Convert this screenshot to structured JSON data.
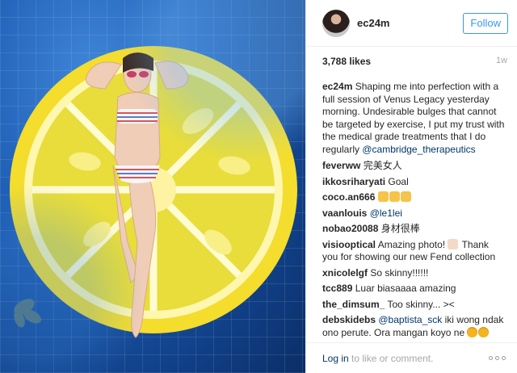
{
  "post": {
    "username": "ec24m",
    "follow_label": "Follow",
    "likes": "3,788 likes",
    "time_ago": "1w"
  },
  "caption": {
    "user": "ec24m",
    "text": "Shaping me into perfection with a full session of Venus Legacy yesterday morning. Undesirable bulges that cannot be targeted by exercise, I put my trust with the medical grade treatments that I do regularly",
    "mention": "@cambridge_therapeutics"
  },
  "comments": [
    {
      "user": "feverww",
      "text": "完美女人"
    },
    {
      "user": "ikkosriharyati",
      "text": "Goal"
    },
    {
      "user": "coco.an666",
      "text": ""
    },
    {
      "user": "vaanlouis",
      "mention": "@le1lei"
    },
    {
      "user": "nobao20088",
      "text": "身材很棒"
    },
    {
      "user": "visiooptical",
      "text_before": "Amazing photo!",
      "text_after": "Thank you for showing our new Fend collection"
    },
    {
      "user": "xnicolelgf",
      "text": "So skinny!!!!!!"
    },
    {
      "user": "tcc889",
      "text": "Luar biasaaaa amazing"
    },
    {
      "user": "the_dimsum_",
      "text": "Too skinny... ><"
    },
    {
      "user": "debskidebs",
      "mention": "@baptista_sck",
      "text": "iki wong ndak ono perute. Ora mangan koyo ne"
    }
  ],
  "footer": {
    "login_link": "Log in",
    "login_text": "to like or comment."
  },
  "icons": {
    "more": "more-options-icon",
    "thumbs": "thumbs-up-emoji",
    "laugh": "laughing-emoji"
  },
  "colors": {
    "follow_blue": "#3897f0",
    "link_blue": "#003569",
    "muted_gray": "#a5a7aa"
  }
}
